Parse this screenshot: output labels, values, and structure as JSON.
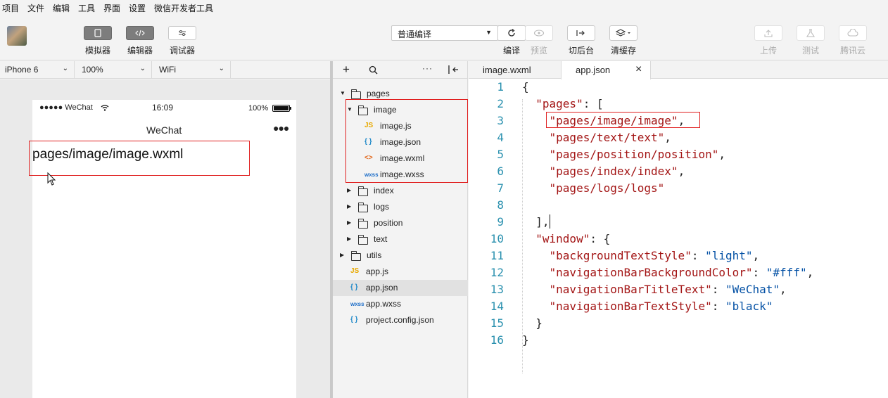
{
  "menu": [
    "项目",
    "文件",
    "编辑",
    "工具",
    "界面",
    "设置",
    "微信开发者工具"
  ],
  "toolbar": {
    "simulator": "模拟器",
    "editor": "编辑器",
    "debugger": "调试器",
    "compile_mode": "普通编译",
    "compile": "编译",
    "preview": "预览",
    "background": "切后台",
    "clear_cache": "清缓存",
    "upload": "上传",
    "test": "测试",
    "cloud": "腾讯云"
  },
  "device_bar": {
    "device": "iPhone 6",
    "zoom": "100%",
    "network": "WiFi"
  },
  "phone": {
    "signal": "●●●●● WeChat",
    "time": "16:09",
    "battery": "100%",
    "nav_title": "WeChat",
    "content": "pages/image/image.wxml"
  },
  "explorer": {
    "rows": [
      {
        "label": "pages",
        "type": "folder-open"
      },
      {
        "label": "image",
        "type": "folder-open"
      },
      {
        "label": "image.js",
        "type": "js"
      },
      {
        "label": "image.json",
        "type": "json"
      },
      {
        "label": "image.wxml",
        "type": "wxml"
      },
      {
        "label": "image.wxss",
        "type": "wxss"
      },
      {
        "label": "index",
        "type": "folder"
      },
      {
        "label": "logs",
        "type": "folder"
      },
      {
        "label": "position",
        "type": "folder"
      },
      {
        "label": "text",
        "type": "folder"
      },
      {
        "label": "utils",
        "type": "folder"
      },
      {
        "label": "app.js",
        "type": "js"
      },
      {
        "label": "app.json",
        "type": "json"
      },
      {
        "label": "app.wxss",
        "type": "wxss"
      },
      {
        "label": "project.config.json",
        "type": "json"
      }
    ],
    "icon_text": {
      "js": "JS",
      "json": "{ }",
      "wxml": "<>",
      "wxss": "wxss"
    }
  },
  "editor": {
    "tabs": [
      "image.wxml",
      "app.json"
    ],
    "line_numbers": [
      "1",
      "2",
      "3",
      "4",
      "5",
      "6",
      "7",
      "8",
      "9",
      "10",
      "11",
      "12",
      "13",
      "14",
      "15",
      "16"
    ],
    "lines": {
      "l1": "{",
      "l2_key": "\"pages\"",
      "l2_rest": ": [",
      "l3": "\"pages/image/image\"",
      "l4": "\"pages/text/text\"",
      "l5": "\"pages/position/position\"",
      "l6": "\"pages/index/index\"",
      "l7": "\"pages/logs/logs\"",
      "l9": "],",
      "l10_key": "\"window\"",
      "l10_rest": ": {",
      "l11_key": "\"backgroundTextStyle\"",
      "l11_val": "\"light\"",
      "l12_key": "\"navigationBarBackgroundColor\"",
      "l12_val": "\"#fff\"",
      "l13_key": "\"navigationBarTitleText\"",
      "l13_val": "\"WeChat\"",
      "l14_key": "\"navigationBarTextStyle\"",
      "l14_val": "\"black\"",
      "l15": "}",
      "l16": "}"
    }
  },
  "colors": {
    "highlight_box": "#e02020",
    "key": "#a31515",
    "string": "#0451a5",
    "line_number": "#2b91af"
  }
}
